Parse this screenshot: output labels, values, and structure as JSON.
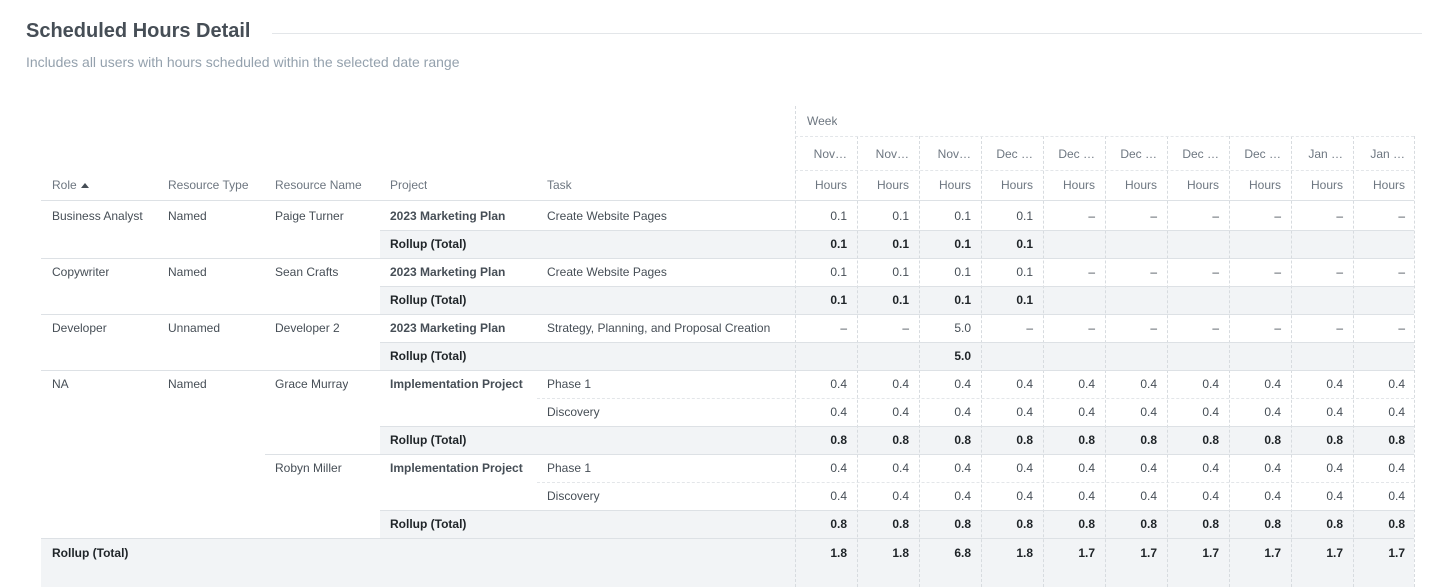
{
  "report": {
    "title": "Scheduled Hours Detail",
    "subtitle": "Includes all users with hours scheduled within the selected date range"
  },
  "table": {
    "group_label": "Week",
    "columns": {
      "role": "Role",
      "resource_type": "Resource Type",
      "resource_name": "Resource Name",
      "project": "Project",
      "task": "Task"
    },
    "sort_indicator": "ascending",
    "weeks": [
      "Nov…",
      "Nov…",
      "Nov…",
      "Dec …",
      "Dec …",
      "Dec …",
      "Dec …",
      "Dec …",
      "Jan …",
      "Jan …"
    ],
    "measure_label": "Hours",
    "rows": [
      {
        "kind": "detail",
        "role": "Business Analyst",
        "resource_type": "Named",
        "resource_name": "Paige Turner",
        "project": "2023 Marketing Plan",
        "task": "Create Website Pages",
        "values": [
          "0.1",
          "0.1",
          "0.1",
          "0.1",
          "–",
          "–",
          "–",
          "–",
          "–",
          "–"
        ]
      },
      {
        "kind": "rollup",
        "label": "Rollup (Total)",
        "values": [
          "0.1",
          "0.1",
          "0.1",
          "0.1",
          "",
          "",
          "",
          "",
          "",
          ""
        ]
      },
      {
        "kind": "detail",
        "role": "Copywriter",
        "resource_type": "Named",
        "resource_name": "Sean Crafts",
        "project": "2023 Marketing Plan",
        "task": "Create Website Pages",
        "values": [
          "0.1",
          "0.1",
          "0.1",
          "0.1",
          "–",
          "–",
          "–",
          "–",
          "–",
          "–"
        ]
      },
      {
        "kind": "rollup",
        "label": "Rollup (Total)",
        "values": [
          "0.1",
          "0.1",
          "0.1",
          "0.1",
          "",
          "",
          "",
          "",
          "",
          ""
        ]
      },
      {
        "kind": "detail",
        "role": "Developer",
        "resource_type": "Unnamed",
        "resource_name": "Developer 2",
        "project": "2023 Marketing Plan",
        "task": "Strategy, Planning, and Proposal Creation",
        "values": [
          "–",
          "–",
          "5.0",
          "–",
          "–",
          "–",
          "–",
          "–",
          "–",
          "–"
        ]
      },
      {
        "kind": "rollup",
        "label": "Rollup (Total)",
        "values": [
          "",
          "",
          "5.0",
          "",
          "",
          "",
          "",
          "",
          "",
          ""
        ]
      },
      {
        "kind": "detail",
        "role": "NA",
        "resource_type": "Named",
        "resource_name": "Grace Murray",
        "project": "Implementation Project",
        "task": "Phase 1",
        "values": [
          "0.4",
          "0.4",
          "0.4",
          "0.4",
          "0.4",
          "0.4",
          "0.4",
          "0.4",
          "0.4",
          "0.4"
        ]
      },
      {
        "kind": "detail",
        "role": "",
        "resource_type": "",
        "resource_name": "",
        "project": "",
        "task": "Discovery",
        "values": [
          "0.4",
          "0.4",
          "0.4",
          "0.4",
          "0.4",
          "0.4",
          "0.4",
          "0.4",
          "0.4",
          "0.4"
        ]
      },
      {
        "kind": "rollup",
        "label": "Rollup (Total)",
        "values": [
          "0.8",
          "0.8",
          "0.8",
          "0.8",
          "0.8",
          "0.8",
          "0.8",
          "0.8",
          "0.8",
          "0.8"
        ]
      },
      {
        "kind": "detail",
        "role": "",
        "resource_type": "",
        "resource_name": "Robyn Miller",
        "project": "Implementation Project",
        "task": "Phase 1",
        "values": [
          "0.4",
          "0.4",
          "0.4",
          "0.4",
          "0.4",
          "0.4",
          "0.4",
          "0.4",
          "0.4",
          "0.4"
        ]
      },
      {
        "kind": "detail",
        "role": "",
        "resource_type": "",
        "resource_name": "",
        "project": "",
        "task": "Discovery",
        "values": [
          "0.4",
          "0.4",
          "0.4",
          "0.4",
          "0.4",
          "0.4",
          "0.4",
          "0.4",
          "0.4",
          "0.4"
        ]
      },
      {
        "kind": "rollup",
        "label": "Rollup (Total)",
        "values": [
          "0.8",
          "0.8",
          "0.8",
          "0.8",
          "0.8",
          "0.8",
          "0.8",
          "0.8",
          "0.8",
          "0.8"
        ]
      }
    ],
    "grand_total": {
      "label": "Rollup (Total)",
      "values": [
        "1.8",
        "1.8",
        "6.8",
        "1.8",
        "1.7",
        "1.7",
        "1.7",
        "1.7",
        "1.7",
        "1.7"
      ]
    }
  }
}
